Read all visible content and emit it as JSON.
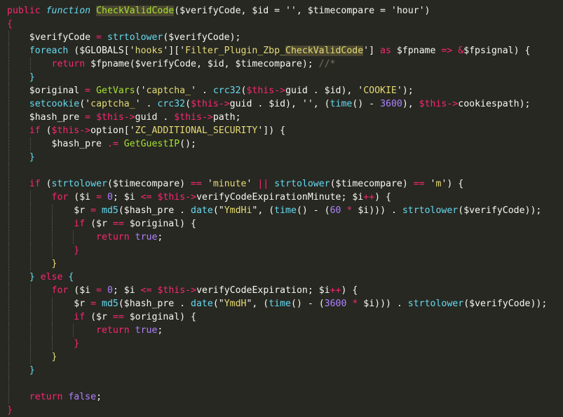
{
  "theme": {
    "background": "#272822",
    "foreground": "#f8f8f2",
    "keyword": "#f92672",
    "storage": "#66d9ef",
    "function": "#a6e22e",
    "string": "#e6db74",
    "number": "#ae81ff",
    "comment": "#75715e",
    "variable": "#f8f8f2",
    "bracket": "#f8f8f2",
    "highlight": "#4a4630"
  },
  "code_lines": [
    [
      {
        "t": "public",
        "c": "#f92672"
      },
      {
        "t": " "
      },
      {
        "t": "function",
        "c": "#66d9ef",
        "i": true
      },
      {
        "t": " "
      },
      {
        "t": "CheckValidCode",
        "c": "#a6e22e",
        "h": true
      },
      {
        "t": "($verifyCode, $id = '', $timecompare = 'hour')"
      }
    ],
    [
      {
        "t": "{",
        "c": "#f92672"
      }
    ],
    [
      {
        "t": "    "
      },
      {
        "t": "$verifyCode"
      },
      {
        "t": " = ",
        "c": "#f92672"
      },
      {
        "t": "strtolower",
        "c": "#66d9ef"
      },
      {
        "t": "($verifyCode);"
      }
    ],
    [
      {
        "t": "    "
      },
      {
        "t": "foreach",
        "c": "#66d9ef"
      },
      {
        "t": " ($GLOBALS['"
      },
      {
        "t": "hooks",
        "c": "#e6db74"
      },
      {
        "t": "']['"
      },
      {
        "t": "Filter_Plugin_Zbp_",
        "c": "#e6db74"
      },
      {
        "t": "CheckValidCode",
        "c": "#e6db74",
        "h": true
      },
      {
        "t": "'] "
      },
      {
        "t": "as",
        "c": "#f92672"
      },
      {
        "t": " $fpname "
      },
      {
        "t": "=>",
        "c": "#f92672"
      },
      {
        "t": " "
      },
      {
        "t": "&",
        "c": "#f92672"
      },
      {
        "t": "$fpsignal) {"
      }
    ],
    [
      {
        "t": "        "
      },
      {
        "t": "return",
        "c": "#f92672"
      },
      {
        "t": " $fpname($verifyCode, $id, $timecompare); "
      },
      {
        "t": "//*",
        "c": "#75715e"
      }
    ],
    [
      {
        "t": "    "
      },
      {
        "t": "}",
        "c": "#66d9ef"
      }
    ],
    [
      {
        "t": "    "
      },
      {
        "t": "$original"
      },
      {
        "t": " = ",
        "c": "#f92672"
      },
      {
        "t": "GetVars",
        "c": "#a6e22e"
      },
      {
        "t": "('"
      },
      {
        "t": "captcha_",
        "c": "#e6db74"
      },
      {
        "t": "' . "
      },
      {
        "t": "crc32",
        "c": "#66d9ef"
      },
      {
        "t": "("
      },
      {
        "t": "$this",
        "c": "#f92672"
      },
      {
        "t": "->",
        "c": "#f92672"
      },
      {
        "t": "guid . $id), '"
      },
      {
        "t": "COOKIE",
        "c": "#e6db74"
      },
      {
        "t": "');"
      }
    ],
    [
      {
        "t": "    "
      },
      {
        "t": "setcookie",
        "c": "#66d9ef"
      },
      {
        "t": "('"
      },
      {
        "t": "captcha_",
        "c": "#e6db74"
      },
      {
        "t": "' . "
      },
      {
        "t": "crc32",
        "c": "#66d9ef"
      },
      {
        "t": "("
      },
      {
        "t": "$this",
        "c": "#f92672"
      },
      {
        "t": "->",
        "c": "#f92672"
      },
      {
        "t": "guid . $id), '', ("
      },
      {
        "t": "time",
        "c": "#66d9ef"
      },
      {
        "t": "() - "
      },
      {
        "t": "3600",
        "c": "#ae81ff"
      },
      {
        "t": "), "
      },
      {
        "t": "$this",
        "c": "#f92672"
      },
      {
        "t": "->",
        "c": "#f92672"
      },
      {
        "t": "cookiespath);"
      }
    ],
    [
      {
        "t": "    "
      },
      {
        "t": "$hash_pre"
      },
      {
        "t": " = ",
        "c": "#f92672"
      },
      {
        "t": "$this",
        "c": "#f92672"
      },
      {
        "t": "->",
        "c": "#f92672"
      },
      {
        "t": "guid . "
      },
      {
        "t": "$this",
        "c": "#f92672"
      },
      {
        "t": "->",
        "c": "#f92672"
      },
      {
        "t": "path;"
      }
    ],
    [
      {
        "t": "    "
      },
      {
        "t": "if",
        "c": "#f92672"
      },
      {
        "t": " ("
      },
      {
        "t": "$this",
        "c": "#f92672"
      },
      {
        "t": "->",
        "c": "#f92672"
      },
      {
        "t": "option['"
      },
      {
        "t": "ZC_ADDITIONAL_SECURITY",
        "c": "#e6db74"
      },
      {
        "t": "']) {"
      }
    ],
    [
      {
        "t": "        "
      },
      {
        "t": "$hash_pre"
      },
      {
        "t": " .= ",
        "c": "#f92672"
      },
      {
        "t": "GetGuestIP",
        "c": "#a6e22e"
      },
      {
        "t": "();"
      }
    ],
    [
      {
        "t": "    "
      },
      {
        "t": "}",
        "c": "#66d9ef"
      }
    ],
    [],
    [
      {
        "t": "    "
      },
      {
        "t": "if",
        "c": "#f92672"
      },
      {
        "t": " ("
      },
      {
        "t": "strtolower",
        "c": "#66d9ef"
      },
      {
        "t": "($timecompare) "
      },
      {
        "t": "==",
        "c": "#f92672"
      },
      {
        "t": " '"
      },
      {
        "t": "minute",
        "c": "#e6db74"
      },
      {
        "t": "' "
      },
      {
        "t": "||",
        "c": "#f92672"
      },
      {
        "t": " "
      },
      {
        "t": "strtolower",
        "c": "#66d9ef"
      },
      {
        "t": "($timecompare) "
      },
      {
        "t": "==",
        "c": "#f92672"
      },
      {
        "t": " '"
      },
      {
        "t": "m",
        "c": "#e6db74"
      },
      {
        "t": "') {"
      }
    ],
    [
      {
        "t": "        "
      },
      {
        "t": "for",
        "c": "#f92672"
      },
      {
        "t": " ($i "
      },
      {
        "t": "=",
        "c": "#f92672"
      },
      {
        "t": " "
      },
      {
        "t": "0",
        "c": "#ae81ff"
      },
      {
        "t": "; $i "
      },
      {
        "t": "<=",
        "c": "#f92672"
      },
      {
        "t": " "
      },
      {
        "t": "$this",
        "c": "#f92672"
      },
      {
        "t": "->",
        "c": "#f92672"
      },
      {
        "t": "verifyCodeExpirationMinute; $i"
      },
      {
        "t": "++",
        "c": "#f92672"
      },
      {
        "t": ") {"
      }
    ],
    [
      {
        "t": "            "
      },
      {
        "t": "$r"
      },
      {
        "t": " = ",
        "c": "#f92672"
      },
      {
        "t": "md5",
        "c": "#66d9ef"
      },
      {
        "t": "($hash_pre . "
      },
      {
        "t": "date",
        "c": "#66d9ef"
      },
      {
        "t": "(\""
      },
      {
        "t": "YmdHi",
        "c": "#e6db74"
      },
      {
        "t": "\", ("
      },
      {
        "t": "time",
        "c": "#66d9ef"
      },
      {
        "t": "() - ("
      },
      {
        "t": "60",
        "c": "#ae81ff"
      },
      {
        "t": " "
      },
      {
        "t": "*",
        "c": "#f92672"
      },
      {
        "t": " $i))) . "
      },
      {
        "t": "strtolower",
        "c": "#66d9ef"
      },
      {
        "t": "($verifyCode));"
      }
    ],
    [
      {
        "t": "            "
      },
      {
        "t": "if",
        "c": "#f92672"
      },
      {
        "t": " ($r "
      },
      {
        "t": "==",
        "c": "#f92672"
      },
      {
        "t": " $original) {"
      }
    ],
    [
      {
        "t": "                "
      },
      {
        "t": "return",
        "c": "#f92672"
      },
      {
        "t": " "
      },
      {
        "t": "true",
        "c": "#ae81ff"
      },
      {
        "t": ";"
      }
    ],
    [
      {
        "t": "            "
      },
      {
        "t": "}",
        "c": "#f92672"
      }
    ],
    [
      {
        "t": "        "
      },
      {
        "t": "}",
        "c": "#e6db74"
      }
    ],
    [
      {
        "t": "    "
      },
      {
        "t": "}",
        "c": "#66d9ef"
      },
      {
        "t": " "
      },
      {
        "t": "else",
        "c": "#f92672"
      },
      {
        "t": " "
      },
      {
        "t": "{",
        "c": "#66d9ef"
      }
    ],
    [
      {
        "t": "        "
      },
      {
        "t": "for",
        "c": "#f92672"
      },
      {
        "t": " ($i "
      },
      {
        "t": "=",
        "c": "#f92672"
      },
      {
        "t": " "
      },
      {
        "t": "0",
        "c": "#ae81ff"
      },
      {
        "t": "; $i "
      },
      {
        "t": "<=",
        "c": "#f92672"
      },
      {
        "t": " "
      },
      {
        "t": "$this",
        "c": "#f92672"
      },
      {
        "t": "->",
        "c": "#f92672"
      },
      {
        "t": "verifyCodeExpiration; $i"
      },
      {
        "t": "++",
        "c": "#f92672"
      },
      {
        "t": ") {"
      }
    ],
    [
      {
        "t": "            "
      },
      {
        "t": "$r"
      },
      {
        "t": " = ",
        "c": "#f92672"
      },
      {
        "t": "md5",
        "c": "#66d9ef"
      },
      {
        "t": "($hash_pre . "
      },
      {
        "t": "date",
        "c": "#66d9ef"
      },
      {
        "t": "(\""
      },
      {
        "t": "YmdH",
        "c": "#e6db74"
      },
      {
        "t": "\", ("
      },
      {
        "t": "time",
        "c": "#66d9ef"
      },
      {
        "t": "() - ("
      },
      {
        "t": "3600",
        "c": "#ae81ff"
      },
      {
        "t": " "
      },
      {
        "t": "*",
        "c": "#f92672"
      },
      {
        "t": " $i))) . "
      },
      {
        "t": "strtolower",
        "c": "#66d9ef"
      },
      {
        "t": "($verifyCode));"
      }
    ],
    [
      {
        "t": "            "
      },
      {
        "t": "if",
        "c": "#f92672"
      },
      {
        "t": " ($r "
      },
      {
        "t": "==",
        "c": "#f92672"
      },
      {
        "t": " $original) {"
      }
    ],
    [
      {
        "t": "                "
      },
      {
        "t": "return",
        "c": "#f92672"
      },
      {
        "t": " "
      },
      {
        "t": "true",
        "c": "#ae81ff"
      },
      {
        "t": ";"
      }
    ],
    [
      {
        "t": "            "
      },
      {
        "t": "}",
        "c": "#f92672"
      }
    ],
    [
      {
        "t": "        "
      },
      {
        "t": "}",
        "c": "#e6db74"
      }
    ],
    [
      {
        "t": "    "
      },
      {
        "t": "}",
        "c": "#66d9ef"
      }
    ],
    [],
    [
      {
        "t": "    "
      },
      {
        "t": "return",
        "c": "#f92672"
      },
      {
        "t": " "
      },
      {
        "t": "false",
        "c": "#ae81ff"
      },
      {
        "t": ";"
      }
    ],
    [
      {
        "t": "}",
        "c": "#f92672"
      }
    ]
  ]
}
